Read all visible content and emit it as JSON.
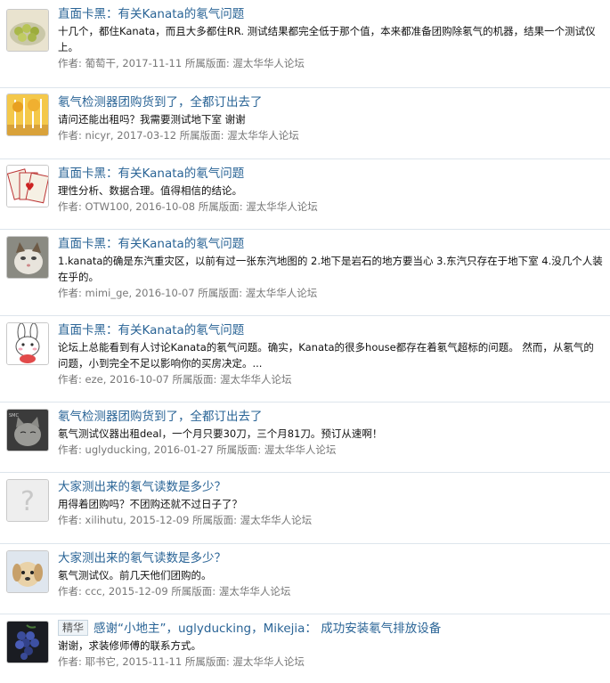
{
  "results": [
    {
      "avatar": "green-bowl-food-image",
      "badge": "",
      "title": "直面卡黑：有关Kanata的氡气问题",
      "snippet_lines": [
        "十几个，都住Kanata，而且大多都住RR. 测试结果都完全低于那个值，本来都准备团购除氡气的机器，结果一个测试仪",
        "上。"
      ],
      "author_label": "作者:",
      "author": "葡萄干",
      "date": "2017-11-11",
      "forum_label": "所属版面:",
      "forum": "渥太华华人论坛"
    },
    {
      "avatar": "autumn-trees-image",
      "badge": "",
      "title": "氡气检测器团购货到了，全都订出去了",
      "snippet_lines": [
        "请问还能出租吗？我需要测试地下室 谢谢"
      ],
      "author_label": "作者:",
      "author": "nicyr",
      "date": "2017-03-12",
      "forum_label": "所属版面:",
      "forum": "渥太华华人论坛"
    },
    {
      "avatar": "playing-cards-image",
      "badge": "",
      "title": "直面卡黑：有关Kanata的氡气问题",
      "snippet_lines": [
        "理性分析、数据合理。值得相信的结论。"
      ],
      "author_label": "作者:",
      "author": "OTW100",
      "date": "2016-10-08",
      "forum_label": "所属版面:",
      "forum": "渥太华华人论坛"
    },
    {
      "avatar": "cat-photo-image",
      "badge": "",
      "title": "直面卡黑：有关Kanata的氡气问题",
      "snippet_lines": [
        "1.kanata的确是东汽重灾区，以前有过一张东汽地图的 2.地下是岩石的地方要当心 3.东汽只存在于地下室 4.没几个人装",
        "在乎的。"
      ],
      "author_label": "作者:",
      "author": "mimi_ge",
      "date": "2016-10-07",
      "forum_label": "所属版面:",
      "forum": "渥太华华人论坛"
    },
    {
      "avatar": "cartoon-bunny-image",
      "badge": "",
      "title": "直面卡黑：有关Kanata的氡气问题",
      "snippet_lines": [
        "论坛上总能看到有人讨论Kanata的氡气问题。确实，Kanata的很多house都存在着氡气超标的问题。 然而，从氡气的",
        "问题，小到完全不足以影响你的买房决定。..."
      ],
      "author_label": "作者:",
      "author": "eze",
      "date": "2016-10-07",
      "forum_label": "所属版面:",
      "forum": "渥太华华人论坛"
    },
    {
      "avatar": "grey-cat-image",
      "badge": "",
      "title": "氡气检测器团购货到了，全都订出去了",
      "snippet_lines": [
        "氡气测试仪器出租deal，一个月只要30刀，三个月81刀。预订从速啊！"
      ],
      "author_label": "作者:",
      "author": "uglyducking",
      "date": "2016-01-27",
      "forum_label": "所属版面:",
      "forum": "渥太华华人论坛"
    },
    {
      "avatar": "question-mark-placeholder-icon",
      "badge": "",
      "title": "大家测出来的氡气读数是多少？",
      "snippet_lines": [
        "用得着团购吗？不团购还就不过日子了？"
      ],
      "author_label": "作者:",
      "author": "xilihutu",
      "date": "2015-12-09",
      "forum_label": "所属版面:",
      "forum": "渥太华华人论坛"
    },
    {
      "avatar": "puppy-photo-image",
      "badge": "",
      "title": "大家测出来的氡气读数是多少？",
      "snippet_lines": [
        "氡气测试仪。前几天他们团购的。"
      ],
      "author_label": "作者:",
      "author": "ccc",
      "date": "2015-12-09",
      "forum_label": "所属版面:",
      "forum": "渥太华华人论坛"
    },
    {
      "avatar": "blue-grapes-image",
      "badge": "精华",
      "title": "感谢“小地主”，uglyducking，Mikejia： 成功安装氡气排放设备",
      "snippet_lines": [
        "谢谢，求装修师傅的联系方式。"
      ],
      "author_label": "作者:",
      "author": "耶书它",
      "date": "2015-11-11",
      "forum_label": "所属版面:",
      "forum": "渥太华华人论坛"
    }
  ]
}
